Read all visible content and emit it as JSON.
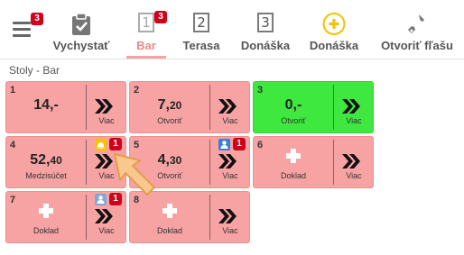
{
  "toolbar": {
    "menu_badge": "3",
    "tools": [
      {
        "label": "Vychystať",
        "icon": "clipboard-check-icon"
      },
      {
        "label": "Bar",
        "number": "1",
        "badge": "3",
        "active": true
      },
      {
        "label": "Terasa",
        "number": "2"
      },
      {
        "label": "Donáška",
        "number": "3"
      },
      {
        "label": "Donáška",
        "icon": "plus-circle-icon"
      },
      {
        "label": "Otvoriť fľašu",
        "icon": "bottle-opener-icon"
      }
    ]
  },
  "section": {
    "title": "Stoly - Bar"
  },
  "tiles": [
    {
      "number": "1",
      "amount": "14,-",
      "sublabel": "",
      "more": "Viac",
      "color": "#f8a3a3"
    },
    {
      "number": "2",
      "amount_main": "7,",
      "amount_dec": "20",
      "sublabel": "Otvoriť",
      "more": "Viac",
      "color": "#f8a3a3"
    },
    {
      "number": "3",
      "amount": "0,-",
      "sublabel": "Otvoriť",
      "more": "Viac",
      "color": "#3fe83f"
    },
    {
      "number": "4",
      "amount_main": "52,",
      "amount_dec": "40",
      "sublabel": "Medzisúčet",
      "more": "Viac",
      "badge": "1",
      "badge_icon": "bell-icon",
      "color": "#f8a3a3"
    },
    {
      "number": "5",
      "amount_main": "4,",
      "amount_dec": "30",
      "sublabel": "Otvoriť",
      "more": "Viac",
      "badge": "1",
      "badge_icon": "person-icon",
      "color": "#f8a3a3"
    },
    {
      "number": "6",
      "sublabel": "Doklad",
      "more": "Viac",
      "color": "#f8a3a3"
    },
    {
      "number": "7",
      "sublabel": "Doklad",
      "more": "Viac",
      "badge": "1",
      "badge_icon": "person-icon",
      "color": "#f8a3a3"
    },
    {
      "number": "8",
      "sublabel": "Doklad",
      "more": "Viac",
      "color": "#f8a3a3"
    }
  ],
  "colors": {
    "badge": "#d0021b",
    "accent_yellow": "#f2c200",
    "tile_red": "#f8a3a3",
    "tile_green": "#3fe83f"
  }
}
